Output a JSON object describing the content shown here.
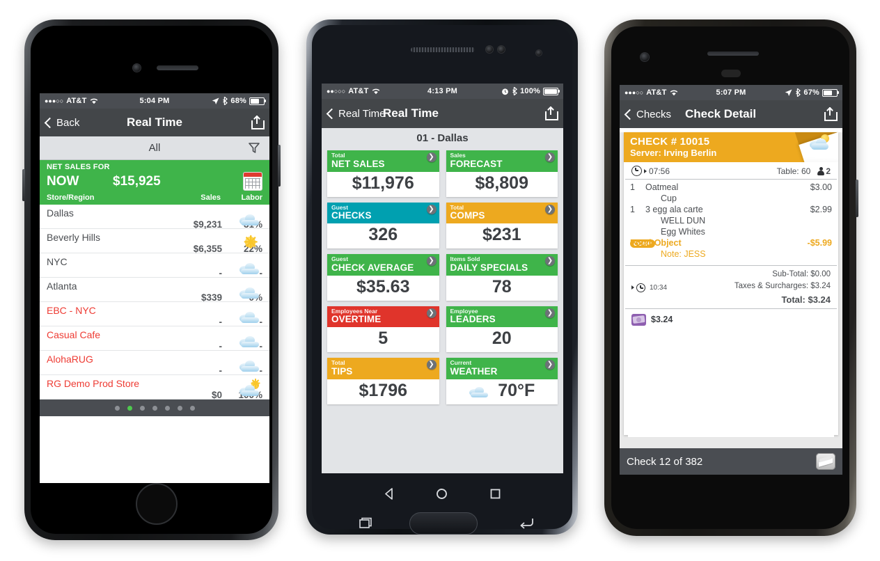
{
  "phone1": {
    "status": {
      "carrier": "AT&T",
      "signal_dots": "●●●○○",
      "wifi": "wifi-icon",
      "time": "5:04 PM",
      "battery_pct": "68%"
    },
    "nav": {
      "back_label": "Back",
      "title": "Real Time",
      "share": "share-icon"
    },
    "filter": {
      "label": "All",
      "icon": "filter-funnel-icon"
    },
    "summary": {
      "caption": "NET SALES FOR",
      "period": "NOW",
      "amount": "$15,925",
      "calendar_icon": "calendar-icon"
    },
    "columns": {
      "store": "Store/Region",
      "sales": "Sales",
      "labor": "Labor"
    },
    "rows": [
      {
        "name": "Dallas",
        "sales": "$9,231",
        "labor": "31%",
        "weather": "cloudy",
        "alert": false
      },
      {
        "name": "Beverly Hills",
        "sales": "$6,355",
        "labor": "22%",
        "weather": "sunny",
        "alert": false
      },
      {
        "name": "NYC",
        "sales": "-",
        "labor": "-",
        "weather": "cloudy",
        "alert": false
      },
      {
        "name": "Atlanta",
        "sales": "$339",
        "labor": "0%",
        "weather": "cloudy",
        "alert": false
      },
      {
        "name": "EBC - NYC",
        "sales": "-",
        "labor": "-",
        "weather": "cloudy",
        "alert": true
      },
      {
        "name": "Casual Cafe",
        "sales": "-",
        "labor": "-",
        "weather": "cloudy",
        "alert": true
      },
      {
        "name": "AlohaRUG",
        "sales": "-",
        "labor": "-",
        "weather": "cloudy",
        "alert": true
      },
      {
        "name": "RG Demo Prod Store",
        "sales": "$0",
        "labor": "100%",
        "weather": "partly-sunny",
        "alert": true
      }
    ],
    "pager": {
      "count": 7,
      "active_index": 1
    }
  },
  "phone2": {
    "status": {
      "carrier": "AT&T",
      "signal_dots": "●●○○○",
      "wifi": "wifi-icon",
      "time": "4:13 PM",
      "battery_pct": "100%"
    },
    "nav": {
      "back_label": "Real Time",
      "title": "Real Time",
      "share": "share-icon"
    },
    "store": "01 - Dallas",
    "tiles": [
      {
        "sub": "Total",
        "main": "NET SALES",
        "value": "$11,976",
        "color": "#3fb44a"
      },
      {
        "sub": "Sales",
        "main": "FORECAST",
        "value": "$8,809",
        "color": "#3fb44a"
      },
      {
        "sub": "Guest",
        "main": "CHECKS",
        "value": "326",
        "color": "#00a0b0"
      },
      {
        "sub": "Total",
        "main": "COMPS",
        "value": "$231",
        "color": "#eda91f"
      },
      {
        "sub": "Guest",
        "main": "CHECK AVERAGE",
        "value": "$35.63",
        "color": "#3fb44a"
      },
      {
        "sub": "Items Sold",
        "main": "DAILY SPECIALS",
        "value": "78",
        "color": "#3fb44a"
      },
      {
        "sub": "Employees Near",
        "main": "OVERTIME",
        "value": "5",
        "color": "#e0342b"
      },
      {
        "sub": "Employee",
        "main": "LEADERS",
        "value": "20",
        "color": "#3fb44a"
      },
      {
        "sub": "Total",
        "main": "TIPS",
        "value": "$1796",
        "color": "#eda91f"
      },
      {
        "sub": "Current",
        "main": "WEATHER",
        "value": "70°F",
        "color": "#3fb44a",
        "icon": "cloudy"
      }
    ],
    "android_nav": {
      "back": "back-triangle-icon",
      "home": "home-circle-icon",
      "recents": "recents-square-icon"
    }
  },
  "phone3": {
    "status": {
      "carrier": "AT&T",
      "signal_dots": "●●●○○",
      "wifi": "wifi-icon",
      "time": "5:07 PM",
      "battery_pct": "67%"
    },
    "nav": {
      "back_label": "Checks",
      "title": "Check Detail",
      "share": "share-icon"
    },
    "check": {
      "number": "CHECK # 10015",
      "server": "Server: Irving Berlin",
      "weather": "partly-sunny",
      "open_time": "07:56",
      "table": "Table: 60",
      "guests": "2",
      "close_time": "10:34"
    },
    "items": [
      {
        "qty": "1",
        "desc": "Oatmeal",
        "price": "$3.00",
        "type": "item"
      },
      {
        "qty": "",
        "desc": "Cup",
        "price": "",
        "type": "mod"
      },
      {
        "qty": "1",
        "desc": "3 egg ala carte",
        "price": "$2.99",
        "type": "item"
      },
      {
        "qty": "",
        "desc": "WELL DUN",
        "price": "",
        "type": "mod"
      },
      {
        "qty": "",
        "desc": "Egg Whites",
        "price": "",
        "type": "mod"
      },
      {
        "qty": "COMP",
        "desc": "Food-Object",
        "price": "-$5.99",
        "type": "comp"
      },
      {
        "qty": "",
        "desc": "Note: JESS",
        "price": "",
        "type": "note"
      }
    ],
    "totals": [
      {
        "label": "Sub-Total:",
        "value": "$0.00"
      },
      {
        "label": "Taxes & Surcharges:",
        "value": "$3.24"
      }
    ],
    "grand_total_label": "Total:",
    "grand_total_value": "$3.24",
    "payment": {
      "icon": "cash-icon",
      "amount": "$3.24"
    },
    "footer": {
      "text": "Check 12 of 382",
      "icon": "keyboard-slide-icon"
    }
  }
}
